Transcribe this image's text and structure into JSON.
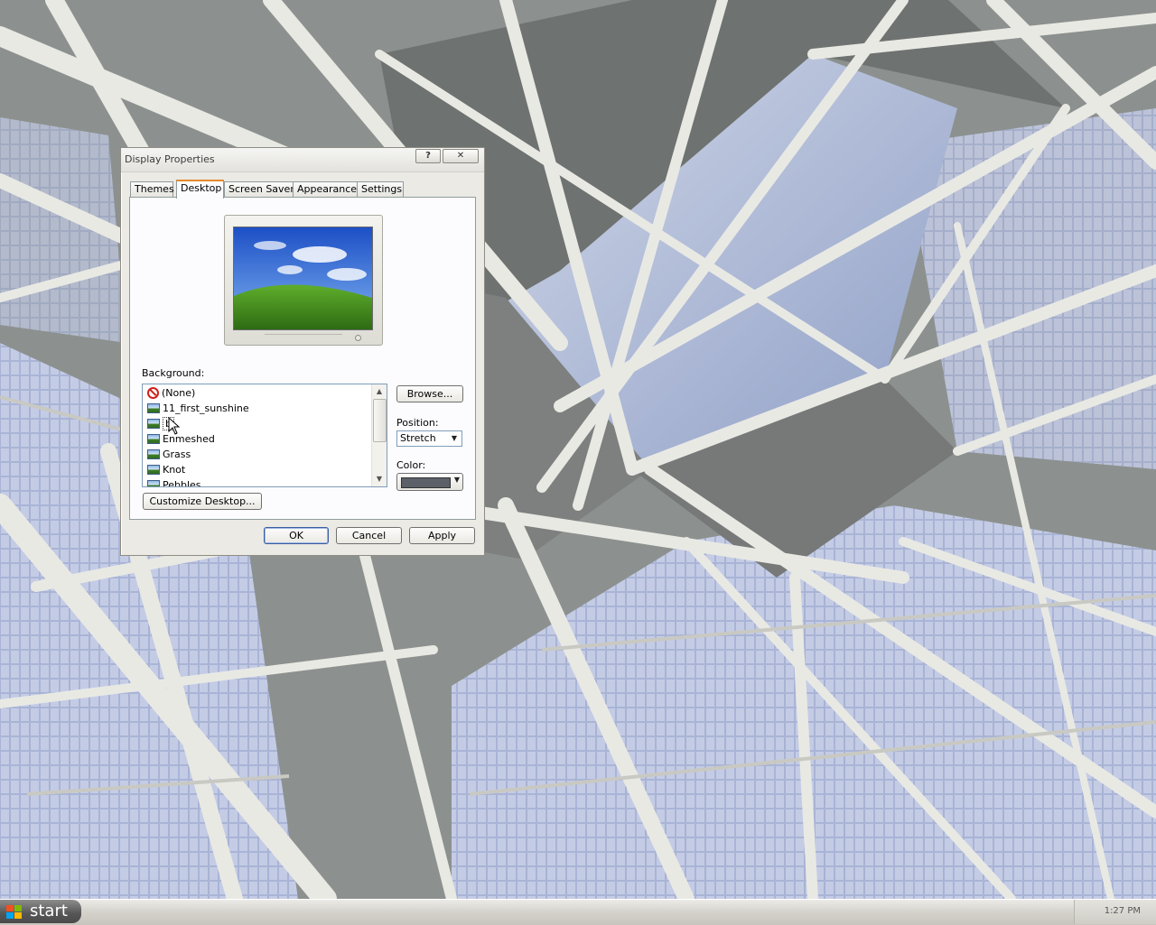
{
  "dialog": {
    "title": "Display Properties",
    "help_button": "?",
    "close_button": "✕",
    "tabs": [
      {
        "label": "Themes"
      },
      {
        "label": "Desktop"
      },
      {
        "label": "Screen Saver"
      },
      {
        "label": "Appearance"
      },
      {
        "label": "Settings"
      }
    ],
    "active_tab": "Desktop",
    "background_label": "Background:",
    "background_items": [
      {
        "label": "(None)",
        "icon": "no-sign-icon"
      },
      {
        "label": "11_first_sunshine",
        "icon": "picture-icon"
      },
      {
        "label": "b",
        "icon": "picture-icon"
      },
      {
        "label": "Enmeshed",
        "icon": "picture-icon"
      },
      {
        "label": "Grass",
        "icon": "picture-icon"
      },
      {
        "label": "Knot",
        "icon": "picture-icon"
      },
      {
        "label": "Pebbles",
        "icon": "picture-icon"
      }
    ],
    "selected_item": "b",
    "browse_button": "Browse...",
    "position_label": "Position:",
    "position_value": "Stretch",
    "color_label": "Color:",
    "color_value": "#5c6068",
    "customize_button": "Customize Desktop...",
    "ok_button": "OK",
    "cancel_button": "Cancel",
    "apply_button": "Apply"
  },
  "taskbar": {
    "start_label": "start",
    "clock": "1:27 PM"
  },
  "colors": {
    "tab_accent": "#e68b2c",
    "focus_border": "#3b5da1"
  }
}
